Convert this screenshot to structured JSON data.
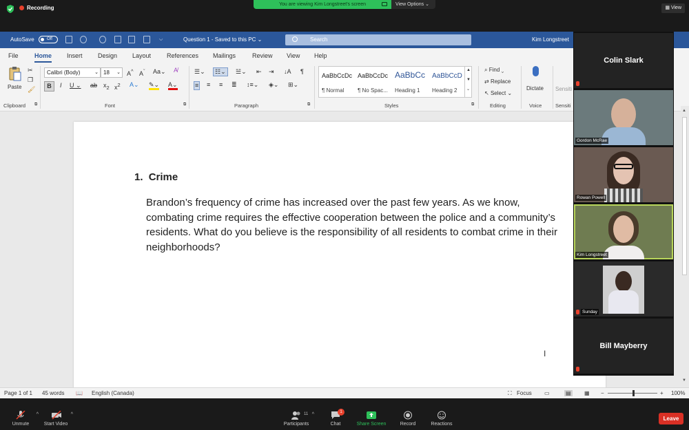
{
  "zoom": {
    "recording_label": "Recording",
    "share_banner": "You are viewing Kim Longstreet's screen",
    "view_options": "View Options",
    "view_button": "View",
    "bottom": {
      "unmute": "Unmute",
      "start_video": "Start Video",
      "participants": "Participants",
      "participants_count": "11",
      "chat": "Chat",
      "chat_badge": "1",
      "share_screen": "Share Screen",
      "record": "Record",
      "reactions": "Reactions",
      "leave": "Leave"
    },
    "participants": [
      {
        "name": "Colin Slark",
        "video": false
      },
      {
        "name": "Gordon McRae",
        "video": true
      },
      {
        "name": "Rowan Powell",
        "video": true
      },
      {
        "name": "Kim Longstreet",
        "video": true
      },
      {
        "name": "Sunday",
        "video": true
      },
      {
        "name": "Bill Mayberry",
        "video": false
      }
    ],
    "accent_green": "#2ec05a",
    "leave_red": "#d93025"
  },
  "word": {
    "autosave_label": "AutoSave",
    "autosave_state": "Off",
    "doc_title": "Question 1  -  Saved to this PC",
    "search_placeholder": "Search",
    "user": "Kim Longstreet",
    "brand_color": "#2b579a",
    "tabs": [
      "File",
      "Home",
      "Insert",
      "Design",
      "Layout",
      "References",
      "Mailings",
      "Review",
      "View",
      "Help"
    ],
    "active_tab": "Home",
    "ribbon": {
      "clipboard": {
        "paste": "Paste",
        "group": "Clipboard"
      },
      "font": {
        "family": "Calibri (Body)",
        "size": "18",
        "group": "Font"
      },
      "paragraph": {
        "group": "Paragraph"
      },
      "styles": {
        "group": "Styles",
        "items": [
          {
            "preview": "AaBbCcDc",
            "name": "¶ Normal"
          },
          {
            "preview": "AaBbCcDc",
            "name": "¶ No Spac..."
          },
          {
            "preview": "AaBbCc",
            "name": "Heading 1"
          },
          {
            "preview": "AaBbCcD",
            "name": "Heading 2"
          }
        ]
      },
      "editing": {
        "find": "Find",
        "replace": "Replace",
        "select": "Select",
        "group": "Editing"
      },
      "voice": {
        "dictate": "Dictate",
        "group": "Voice"
      },
      "sensitivity": {
        "label": "Sensiti",
        "group": "Sensiti"
      }
    },
    "document": {
      "list_number": "1.",
      "heading": "Crime",
      "paragraph": "Brandon’s frequency of crime has increased over the past few years. As we know, combating crime requires the effective cooperation between the police and a community’s residents. What do you believe is the responsibility of all residents to combat crime in their neighborhoods?"
    },
    "status": {
      "page": "Page 1 of 1",
      "words": "45 words",
      "language": "English (Canada)",
      "focus": "Focus",
      "zoom": "100%"
    }
  }
}
